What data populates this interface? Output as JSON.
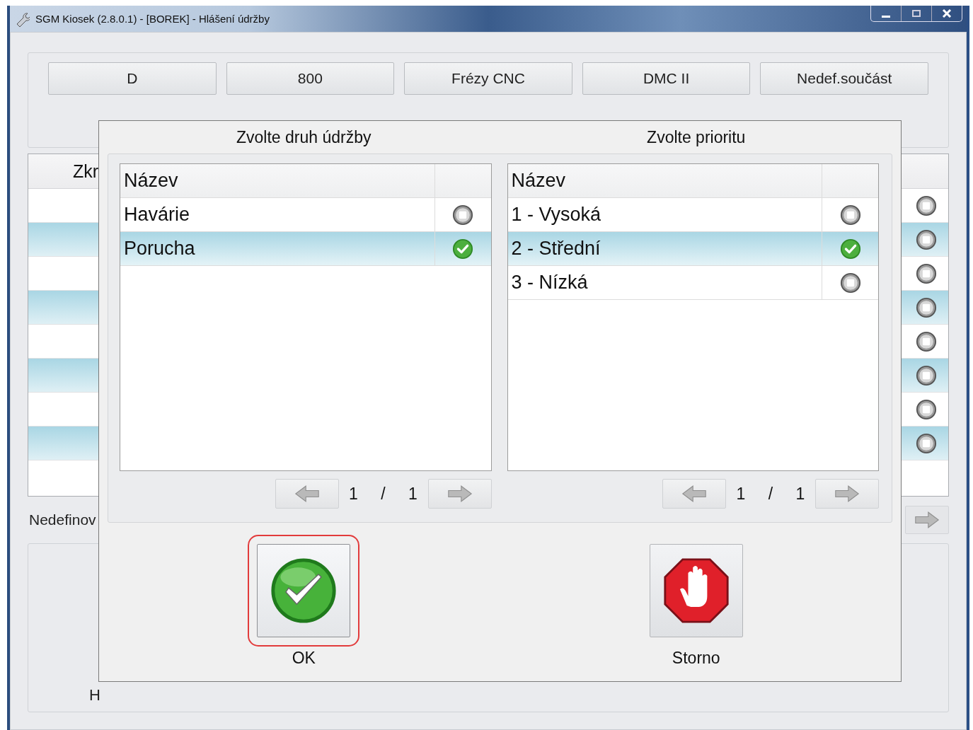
{
  "window": {
    "title": "SGM Kiosek (2.8.0.1) - [BOREK] - Hlášení údržby"
  },
  "toolbar": {
    "buttons": [
      "D",
      "800",
      "Frézy CNC",
      "DMC II",
      "Nedef.součást"
    ]
  },
  "table": {
    "header": "Zkr",
    "rows": [
      {
        "checked": false
      },
      {
        "checked": false
      },
      {
        "checked": false
      },
      {
        "checked": false
      },
      {
        "checked": false
      },
      {
        "checked": false
      },
      {
        "checked": false
      },
      {
        "checked": false
      }
    ]
  },
  "undefined_label": "Nedefinov",
  "bottom_panel": {
    "text": "H"
  },
  "dialog": {
    "panels": [
      {
        "title": "Zvolte druh údržby",
        "column": "Název",
        "rows": [
          {
            "label": "Havárie",
            "selected": false
          },
          {
            "label": "Porucha",
            "selected": true
          }
        ],
        "pager": {
          "page": "1",
          "separator": "/",
          "total": "1"
        }
      },
      {
        "title": "Zvolte prioritu",
        "column": "Název",
        "rows": [
          {
            "label": "1 - Vysoká",
            "selected": false
          },
          {
            "label": "2 - Střední",
            "selected": true
          },
          {
            "label": "3 - Nízká",
            "selected": false
          }
        ],
        "pager": {
          "page": "1",
          "separator": "/",
          "total": "1"
        }
      }
    ],
    "buttons": [
      {
        "label": "OK",
        "kind": "ok",
        "focused": true
      },
      {
        "label": "Storno",
        "kind": "cancel",
        "focused": false
      }
    ]
  }
}
